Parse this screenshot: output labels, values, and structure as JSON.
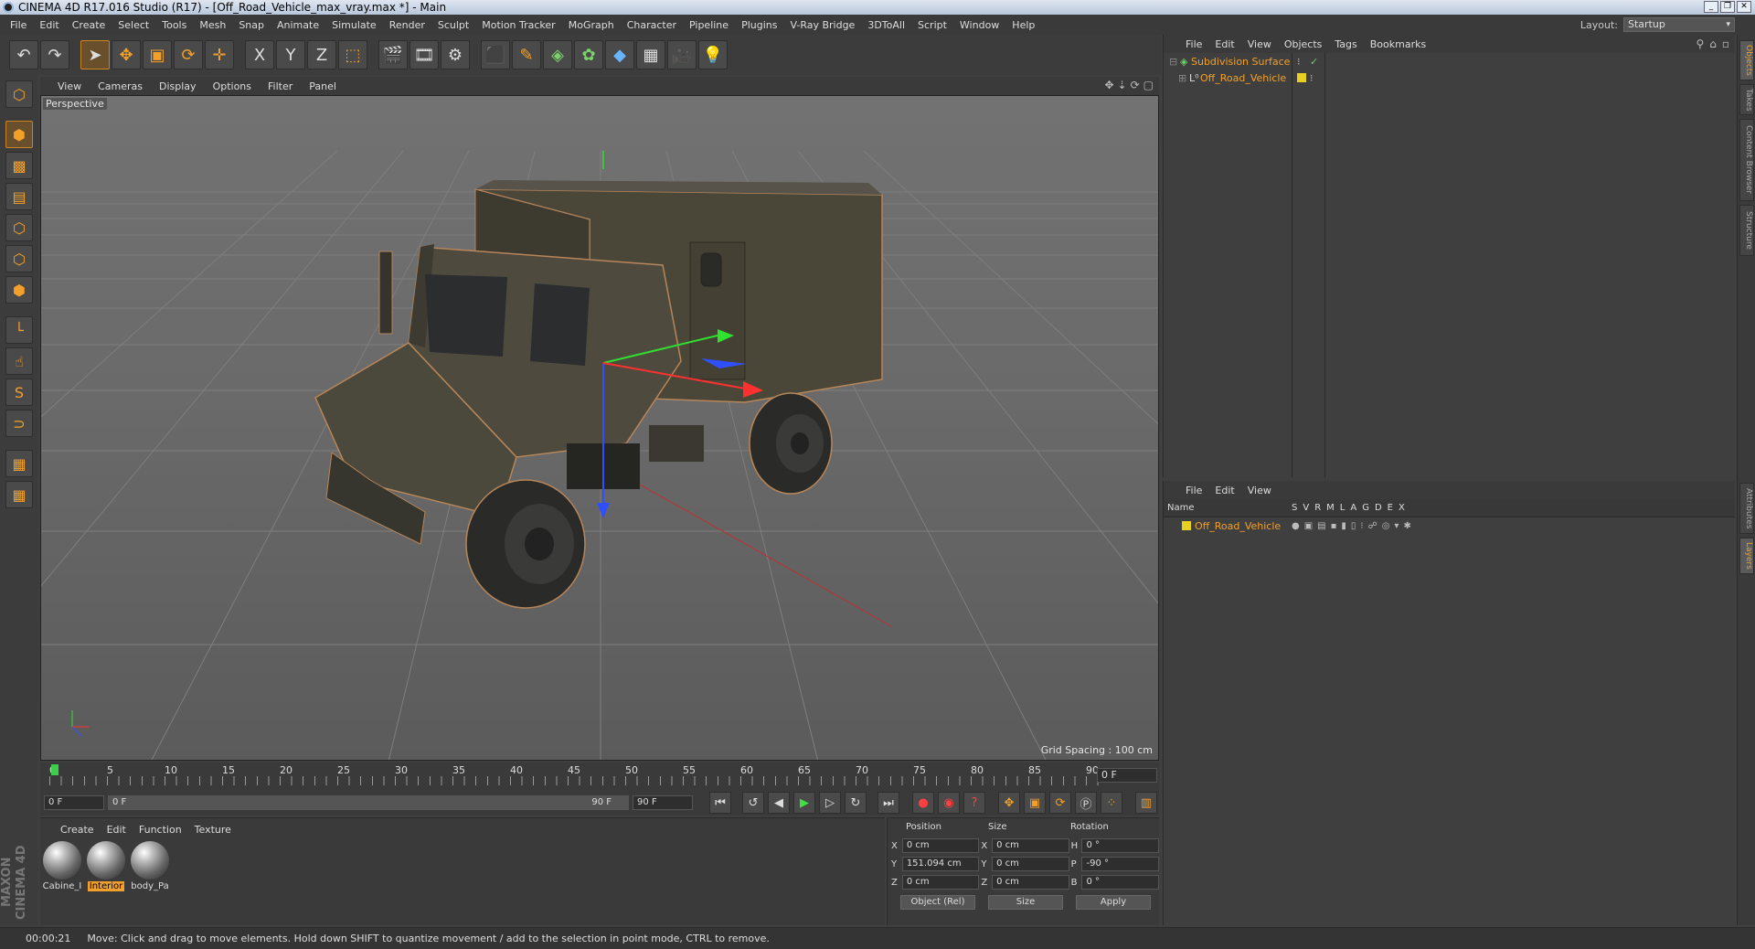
{
  "window": {
    "title": "CINEMA 4D R17.016 Studio (R17) - [Off_Road_Vehicle_max_vray.max *] - Main",
    "controls": [
      "_",
      "❐",
      "✕"
    ]
  },
  "menubar": {
    "items": [
      "File",
      "Edit",
      "Create",
      "Select",
      "Tools",
      "Mesh",
      "Snap",
      "Animate",
      "Simulate",
      "Render",
      "Sculpt",
      "Motion Tracker",
      "MoGraph",
      "Character",
      "Pipeline",
      "Plugins",
      "V-Ray Bridge",
      "3DToAll",
      "Script",
      "Window",
      "Help"
    ],
    "layout_label": "Layout:",
    "layout_value": "Startup"
  },
  "toolbar_icons": [
    "undo-icon",
    "redo-icon",
    "live-selection-icon",
    "move-icon",
    "scale-icon",
    "rotate-icon",
    "recent-tool-icon",
    "x-axis-icon",
    "y-axis-icon",
    "z-axis-icon",
    "coordinate-system-icon",
    "render-view-icon",
    "render-picture-viewer-icon",
    "render-settings-icon",
    "cube-icon",
    "pen-spline-icon",
    "subdivision-icon",
    "cloner-icon",
    "deformer-icon",
    "floor-icon",
    "camera-icon",
    "light-icon"
  ],
  "toolbar_glyphs": [
    "↶",
    "↷",
    "➤",
    "✥",
    "▣",
    "⟳",
    "✛",
    "X",
    "Y",
    "Z",
    "⬚",
    "🎬",
    "🎞",
    "⚙",
    "⬛",
    "✎",
    "◈",
    "✿",
    "◆",
    "▦",
    "🎥",
    "💡"
  ],
  "left_tools": [
    {
      "name": "make-editable-icon",
      "glyph": "⬡"
    },
    {
      "name": "model-mode-icon",
      "glyph": "⬢"
    },
    {
      "name": "texture-mode-icon",
      "glyph": "▩"
    },
    {
      "name": "workplane-icon",
      "glyph": "▤"
    },
    {
      "name": "points-mode-icon",
      "glyph": "⬡"
    },
    {
      "name": "edges-mode-icon",
      "glyph": "⬡"
    },
    {
      "name": "polygons-mode-icon",
      "glyph": "⬢"
    },
    {
      "name": "axis-mode-icon",
      "glyph": "└"
    },
    {
      "name": "tweak-mode-icon",
      "glyph": "☝"
    },
    {
      "name": "snapping-icon",
      "glyph": "S"
    },
    {
      "name": "magnet-icon",
      "glyph": "⊃"
    },
    {
      "name": "locked-workplane-icon",
      "glyph": "▦"
    },
    {
      "name": "workplane-rotate-icon",
      "glyph": "▦"
    }
  ],
  "maxon_logo": "MAXON CINEMA 4D",
  "viewport": {
    "menu": [
      "View",
      "Cameras",
      "Display",
      "Options",
      "Filter",
      "Panel"
    ],
    "nav_icons": [
      "✥",
      "⇣",
      "⟳",
      "▢"
    ],
    "label": "Perspective",
    "grid_spacing": "Grid Spacing : 100 cm"
  },
  "timeline": {
    "ticks": [
      "0",
      "5",
      "10",
      "15",
      "20",
      "25",
      "30",
      "35",
      "40",
      "45",
      "50",
      "55",
      "60",
      "65",
      "70",
      "75",
      "80",
      "85",
      "90"
    ],
    "current_frame": "0 F"
  },
  "transport": {
    "start": "0 F",
    "range_start": "0 F",
    "range_end": "90 F",
    "end": "90 F"
  },
  "material_manager": {
    "menu": [
      "Create",
      "Edit",
      "Function",
      "Texture"
    ],
    "materials": [
      {
        "name": "Cabine_I",
        "selected": false
      },
      {
        "name": "Interior",
        "selected": true
      },
      {
        "name": "body_Pa",
        "selected": false
      }
    ]
  },
  "coordinates": {
    "headers": [
      "Position",
      "Size",
      "Rotation"
    ],
    "rows": [
      {
        "pa": "X",
        "pv": "0 cm",
        "sa": "X",
        "sv": "0 cm",
        "ra": "H",
        "rv": "0 °"
      },
      {
        "pa": "Y",
        "pv": "151.094 cm",
        "sa": "Y",
        "sv": "0 cm",
        "ra": "P",
        "rv": "-90 °"
      },
      {
        "pa": "Z",
        "pv": "0 cm",
        "sa": "Z",
        "sv": "0 cm",
        "ra": "B",
        "rv": "0 °"
      }
    ],
    "mode": "Object (Rel)",
    "size_mode": "Size",
    "apply": "Apply"
  },
  "object_manager": {
    "menu": [
      "File",
      "Edit",
      "View",
      "Objects",
      "Tags",
      "Bookmarks"
    ],
    "objects": [
      {
        "name": "Subdivision Surface",
        "depth": 0
      },
      {
        "name": "Off_Road_Vehicle",
        "depth": 1
      }
    ]
  },
  "layer_manager": {
    "menu": [
      "File",
      "Edit",
      "View"
    ],
    "col_name": "Name",
    "cols": [
      "S",
      "V",
      "R",
      "M",
      "L",
      "A",
      "G",
      "D",
      "E",
      "X"
    ],
    "layers": [
      "Off_Road_Vehicle"
    ]
  },
  "right_tabs": [
    "Objects",
    "Takes",
    "Content Browser",
    "Structure",
    "Attributes",
    "Layers"
  ],
  "status": {
    "time": "00:00:21",
    "message": "Move: Click and drag to move elements. Hold down SHIFT to quantize movement / add to the selection in point mode, CTRL to remove."
  },
  "colors": {
    "accent": "#f2a02a",
    "x_axis": "#ff3030",
    "y_axis": "#30e030",
    "z_axis": "#3050ff",
    "truck_body": "#4e4a3e"
  }
}
